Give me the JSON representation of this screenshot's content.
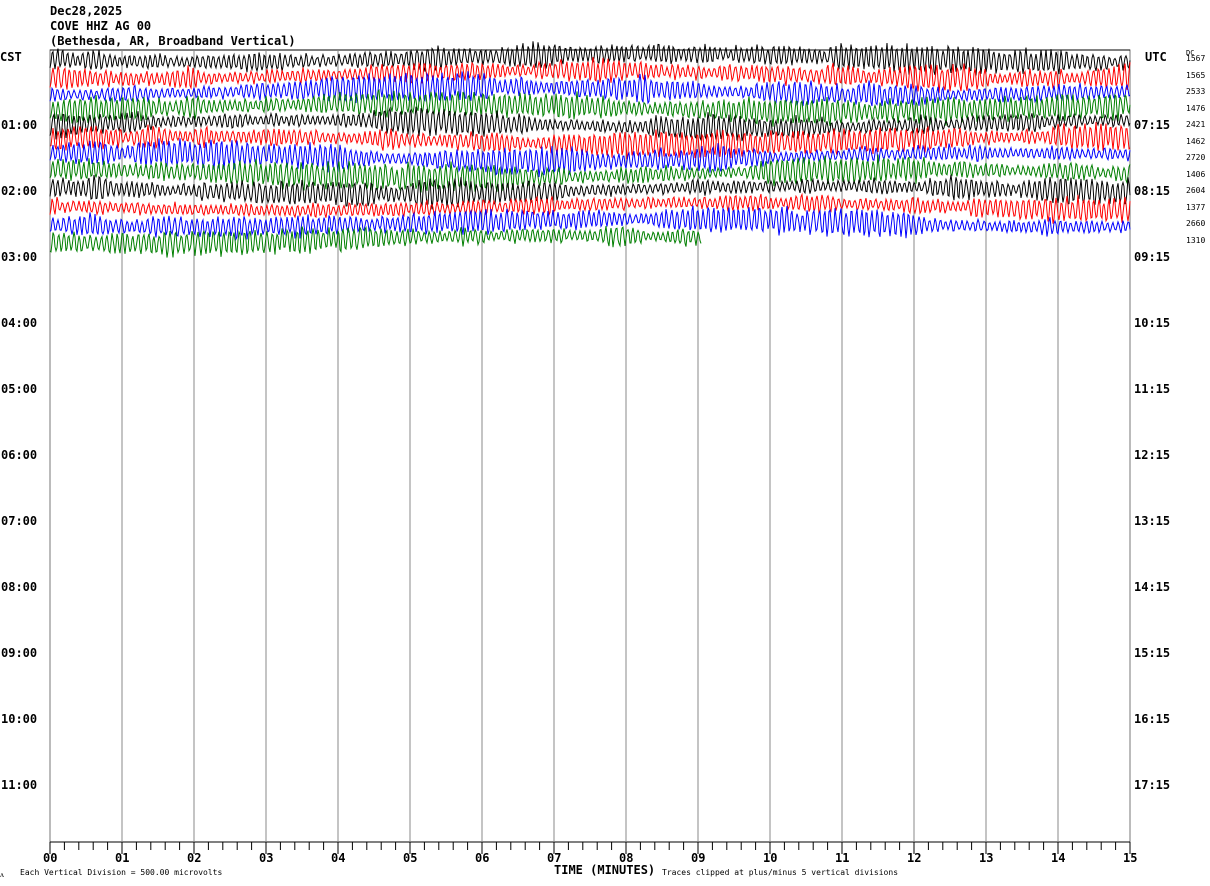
{
  "header": {
    "date": "Dec28,2025",
    "station": "COVE HHZ AG 00",
    "location": "(Bethesda, AR, Broadband Vertical)"
  },
  "left_zone": "CST",
  "right_zone": "UTC",
  "dc_label": "DC",
  "footer": {
    "scale": "Each Vertical Division =  500.00 microvolts",
    "xlabel": "TIME (MINUTES)",
    "clip_note": "Traces clipped at plus/minus 5 vertical divisions"
  },
  "chart_data": {
    "type": "line",
    "subtype": "helicorder",
    "xlabel": "TIME (MINUTES)",
    "xlim": [
      0,
      15
    ],
    "x_ticks": [
      "00",
      "01",
      "02",
      "03",
      "04",
      "05",
      "06",
      "07",
      "08",
      "09",
      "10",
      "11",
      "12",
      "13",
      "14",
      "15"
    ],
    "minor_tick_seconds": 12,
    "left_hour_labels": [
      "",
      "01:00",
      "02:00",
      "03:00",
      "04:00",
      "05:00",
      "06:00",
      "07:00",
      "08:00",
      "09:00",
      "10:00",
      "11:00"
    ],
    "right_hour_labels": [
      "",
      "07:15",
      "08:15",
      "09:15",
      "10:15",
      "11:15",
      "12:15",
      "13:15",
      "14:15",
      "15:15",
      "16:15",
      "17:15"
    ],
    "vertical_grid": true,
    "trace_colors": [
      "#000000",
      "#ff0000",
      "#0000ff",
      "#007f00"
    ],
    "rows": [
      {
        "dc": "1567",
        "end_minute": 15
      },
      {
        "dc": "1565",
        "end_minute": 15
      },
      {
        "dc": "2533",
        "end_minute": 15
      },
      {
        "dc": "1476",
        "end_minute": 15
      },
      {
        "dc": "2421",
        "end_minute": 15
      },
      {
        "dc": "1462",
        "end_minute": 15
      },
      {
        "dc": "2720",
        "end_minute": 15
      },
      {
        "dc": "1406",
        "end_minute": 15
      },
      {
        "dc": "2604",
        "end_minute": 15
      },
      {
        "dc": "1377",
        "end_minute": 15
      },
      {
        "dc": "2660",
        "end_minute": 15
      },
      {
        "dc": "1310",
        "end_minute": 9.05
      }
    ]
  }
}
